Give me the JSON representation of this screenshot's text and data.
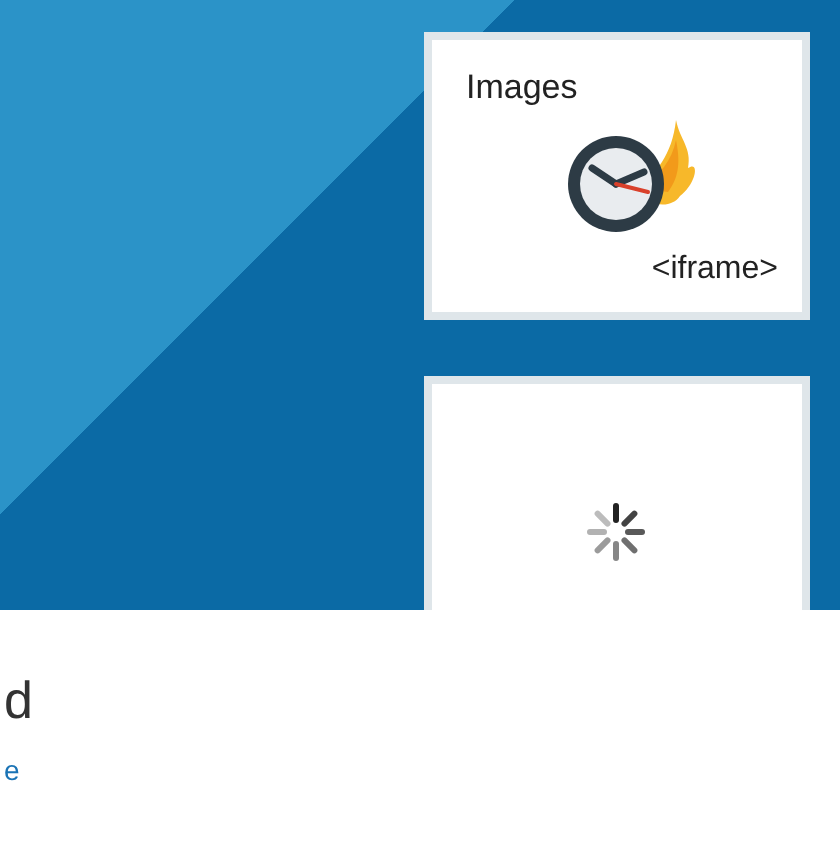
{
  "cards": [
    {
      "kind": "content",
      "title": "Images",
      "caption": "<iframe>"
    },
    {
      "kind": "loading"
    }
  ],
  "heading": "d",
  "link": "e"
}
